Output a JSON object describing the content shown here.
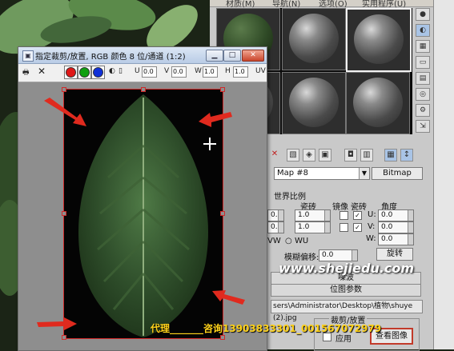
{
  "viewer": {
    "title": "指定裁剪/放置, RGB 颜色 8 位/通道 (1:2)",
    "toolbar": {
      "u_label": "U",
      "v_label": "V",
      "w_label": "W",
      "h_label": "H",
      "uv_label": "UV",
      "u_value": "0.0",
      "v_value": "0.0",
      "w_value": "1.0",
      "h_value": "1.0"
    },
    "buttons": {
      "minimize": "▁",
      "maximize": "□",
      "close": "✕"
    }
  },
  "material_editor": {
    "menu_items": [
      "材质(M)",
      "导航(N)",
      "选项(O)",
      "实用程序(U)"
    ],
    "map_name": "Map #8",
    "map_type_button": "Bitmap",
    "tiling_header": "世界比例",
    "tiling_label": "瓷砖",
    "mirror_label": "镜像",
    "tile_label": "瓷砖",
    "angle_label": "角度",
    "u_label": "U:",
    "v_label": "V:",
    "w_label": "W:",
    "vw_label": "VW",
    "wu_label": "WU",
    "blur_offset_label": "模糊偏移:",
    "blur_offset_value": "0.0",
    "rotate_button": "旋转",
    "tiling_values": [
      "1.0",
      "1.0"
    ],
    "angle_values": [
      "0.0",
      "0.0",
      "0.0"
    ],
    "left_values": [
      "0.0",
      "0.0"
    ],
    "noise_rollout": "噪波",
    "bitmap_params_rollout": "位图参数",
    "bitmap_path": "sers\\Administrator\\Desktop\\植物\\shuye (2).jpg",
    "crop_group_title": "裁剪/放置",
    "apply_label": "应用",
    "view_image_button": "查看图像"
  },
  "overlay": {
    "watermark": "www.shejiedu.com",
    "contact": "代理_______咨询13903833301_001567072979"
  },
  "colors": {
    "red_swatch": "#e01818",
    "green_swatch": "#10a010",
    "blue_swatch": "#1030d8",
    "annotation_red": "#e02a1e",
    "highlight_red": "#c23a2a"
  }
}
